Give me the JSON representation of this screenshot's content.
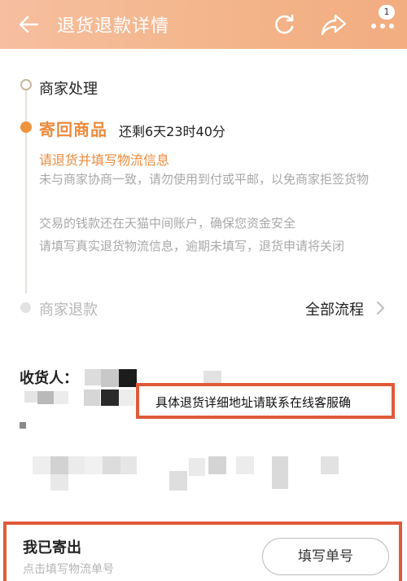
{
  "header": {
    "title": "退货退款详情",
    "badge_count": "1",
    "icons": [
      "back-arrow-icon",
      "refresh-icon",
      "share-icon",
      "more-icon"
    ]
  },
  "timeline": {
    "step_merchant_process": "商家处理",
    "step_return_goods": "寄回商品",
    "countdown": "还剩6天23时40分",
    "instruction": "请退货并填写物流信息",
    "notes": [
      "未与商家协商一致，请勿使用到付或平邮，以免商家拒签货物",
      "交易的钱款还在天猫中间账户，确保您资金安全",
      "请填写真实退货物流信息，逾期未填写，退货申请将关闭"
    ],
    "step_merchant_refund": "商家退款",
    "all_flow_link": "全部流程"
  },
  "recipient": {
    "label": "收货人：",
    "address_note": "具体退货详细地址请联系在线客服确"
  },
  "shipping": {
    "title": "我已寄出",
    "hint": "点击填写物流单号",
    "fill_button": "填写单号"
  },
  "colors": {
    "header_gradient_start": "#f6bf9f",
    "header_gradient_end": "#f2ad80",
    "accent_orange": "#ee8a3c",
    "highlight_red": "#e05a3a"
  }
}
